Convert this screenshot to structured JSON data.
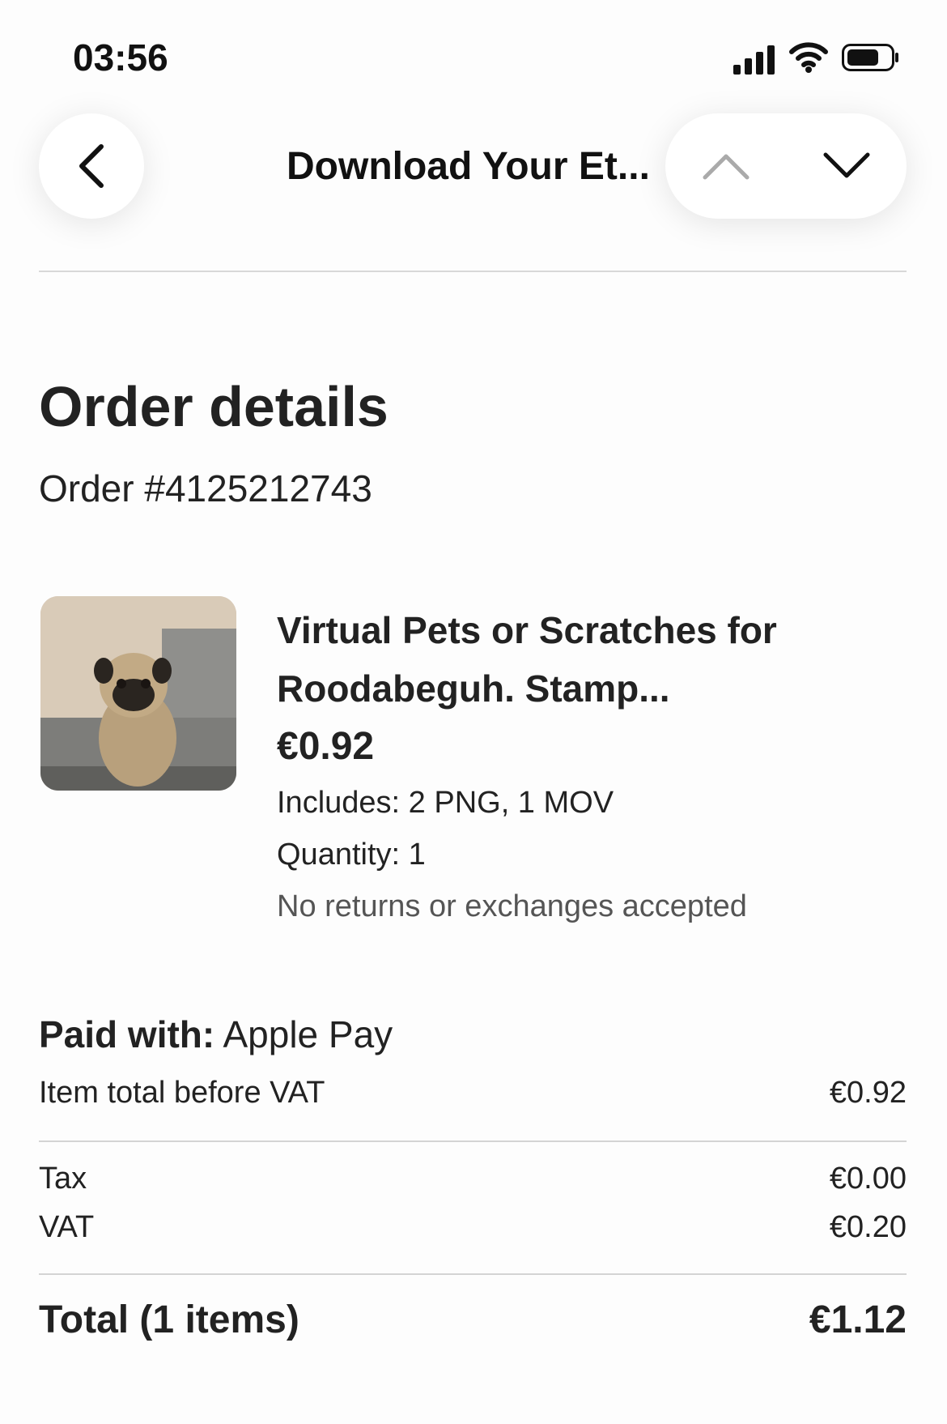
{
  "status_bar": {
    "time": "03:56"
  },
  "nav": {
    "title": "Download Your Et..."
  },
  "page": {
    "heading": "Order details",
    "order_number": "Order #4125212743"
  },
  "item": {
    "title": "Virtual Pets or Scratches for Roodabeguh. Stamp...",
    "price": "€0.92",
    "includes": "Includes: 2 PNG, 1 MOV",
    "quantity": "Quantity: 1",
    "returns": "No returns or exchanges accepted"
  },
  "payment": {
    "label": "Paid with:",
    "method": "Apple Pay"
  },
  "summary": {
    "item_total_label": "Item total before VAT",
    "item_total_value": "€0.92",
    "tax_label": "Tax",
    "tax_value": "€0.00",
    "vat_label": "VAT",
    "vat_value": "€0.20",
    "total_label": "Total (1 items)",
    "total_value": "€1.12"
  },
  "icons": {
    "back": "chevron-left-icon",
    "up": "chevron-up-icon",
    "down": "chevron-down-icon",
    "signal": "cellular-signal-icon",
    "wifi": "wifi-icon",
    "battery": "battery-icon"
  }
}
